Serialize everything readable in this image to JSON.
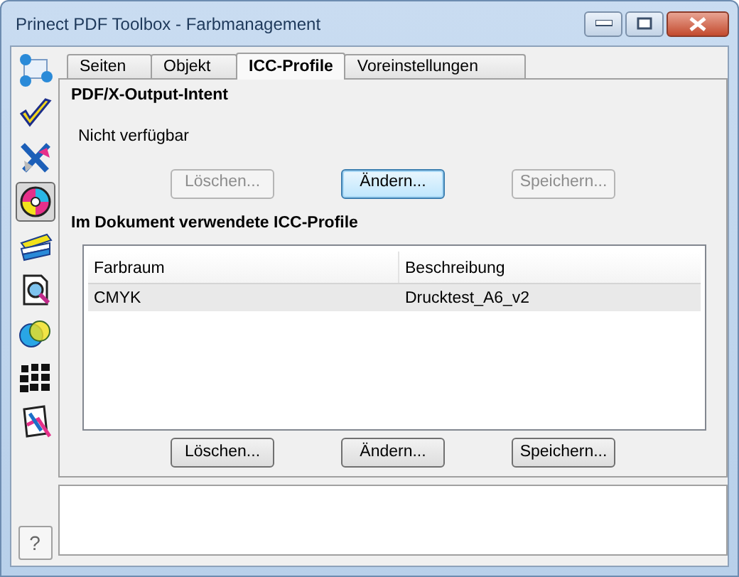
{
  "window": {
    "title": "Prinect PDF Toolbox - Farbmanagement"
  },
  "sidebar": {
    "items": [
      {
        "selected": false
      },
      {
        "selected": false
      },
      {
        "selected": false
      },
      {
        "selected": true
      },
      {
        "selected": false
      },
      {
        "selected": false
      },
      {
        "selected": false
      },
      {
        "selected": false
      },
      {
        "selected": false
      }
    ],
    "help": "?"
  },
  "tabs": [
    {
      "label": "Seiten",
      "selected": false
    },
    {
      "label": "Objekt",
      "selected": false
    },
    {
      "label": "ICC-Profile",
      "selected": true
    },
    {
      "label": "Voreinstellungen",
      "selected": false
    }
  ],
  "output_intent": {
    "heading": "PDF/X-Output-Intent",
    "status": "Nicht verfügbar",
    "buttons": [
      {
        "label": "Löschen...",
        "disabled": true,
        "default": false
      },
      {
        "label": "Ändern...",
        "disabled": false,
        "default": true
      },
      {
        "label": "Speichern...",
        "disabled": true,
        "default": false
      }
    ]
  },
  "profiles": {
    "heading": "Im Dokument verwendete ICC-Profile",
    "columns": [
      "Farbraum",
      "Beschreibung"
    ],
    "rows": [
      {
        "cells": [
          "CMYK",
          "Drucktest_A6_v2"
        ],
        "selected": true
      }
    ],
    "buttons": [
      {
        "label": "Löschen...",
        "disabled": false,
        "default": false
      },
      {
        "label": "Ändern...",
        "disabled": false,
        "default": false
      },
      {
        "label": "Speichern...",
        "disabled": false,
        "default": false
      }
    ]
  }
}
